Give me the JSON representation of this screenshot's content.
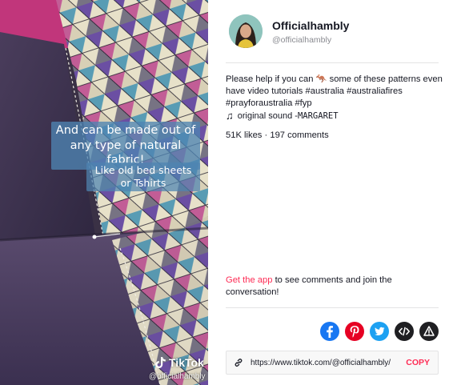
{
  "video": {
    "caption_main": "And can be made out of any type of natural fabric!",
    "caption_sub": "Like old bed sheets or Tshirts",
    "brand": "TikTok",
    "handle": "@officialhambly"
  },
  "author": {
    "display_name": "Officialhambly",
    "username": "@officialhambly"
  },
  "post": {
    "description_prefix": "Please help if you can ",
    "description_emoji": "🦘",
    "description_rest": " some of these patterns even have video tutorials ",
    "hashtags": [
      "#australia",
      "#australiafires",
      "#prayforaustralia",
      "#fyp"
    ],
    "music_prefix": "original sound - ",
    "music_artist": "MARGARET",
    "likes": "51K likes",
    "separator": " · ",
    "comments": "197 comments"
  },
  "cta": {
    "link_text": "Get the app",
    "rest_text": " to see comments and join the conversation!"
  },
  "share": {
    "icons": [
      "facebook-icon",
      "pinterest-icon",
      "twitter-icon",
      "embed-icon",
      "report-icon"
    ]
  },
  "url_box": {
    "url": "https://www.tiktok.com/@officialhambly/",
    "copy_label": "COPY"
  },
  "colors": {
    "accent": "#fe2c55",
    "facebook": "#1877f2",
    "pinterest": "#e60023",
    "twitter": "#1da1f2"
  }
}
